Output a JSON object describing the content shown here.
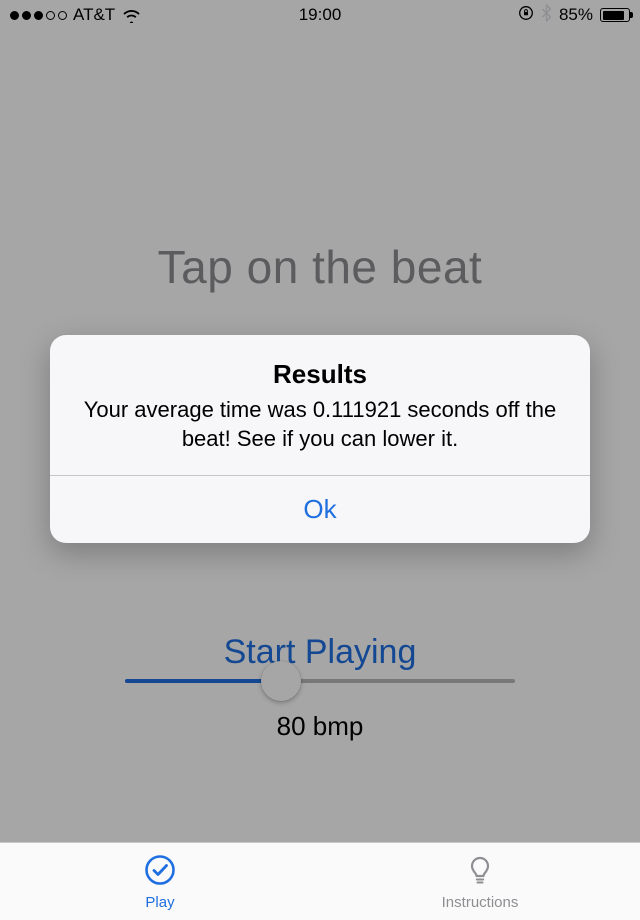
{
  "status": {
    "carrier": "AT&T",
    "time": "19:00",
    "battery_pct": "85%"
  },
  "main": {
    "title": "Tap on the beat",
    "start_label": "Start Playing",
    "bpm_label": "80 bmp"
  },
  "tabs": {
    "play": "Play",
    "instructions": "Instructions"
  },
  "alert": {
    "title": "Results",
    "message": "Your average time was 0.111921 seconds off the beat! See if you can lower it.",
    "ok_label": "Ok"
  },
  "colors": {
    "accent": "#1f6fe0",
    "gray_text": "#8e8e93"
  }
}
